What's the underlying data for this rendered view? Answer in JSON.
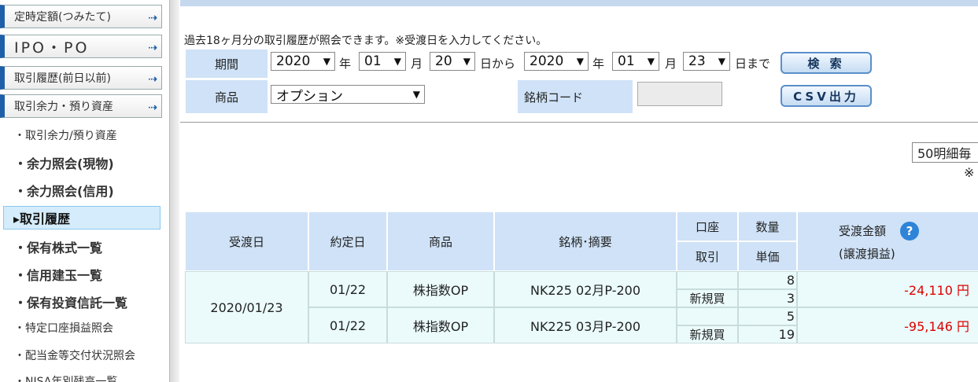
{
  "sidebar": {
    "menus": [
      {
        "label": "定時定額(つみたて)",
        "arrow": "⇢"
      },
      {
        "label": "IPO・PO",
        "arrow": "⇢"
      },
      {
        "label": "取引履歴(前日以前)",
        "arrow": "⇢"
      },
      {
        "label": "取引余力・預り資産",
        "arrow": "⇢"
      }
    ],
    "sub_items": [
      "・取引余力/預り資産",
      "・余力照会(現物)",
      "・余力照会(信用)",
      "・保有株式一覧",
      "・信用建玉一覧",
      "・保有投資信託一覧",
      "・特定口座損益照会",
      "・配当金等交付状況照会",
      "・NISA年別残高一覧"
    ],
    "active_item": "▸取引履歴"
  },
  "search": {
    "intro": "過去18ヶ月分の取引履歴が照会できます。※受渡日を入力してください。",
    "period_label": "期間",
    "product_label": "商品",
    "code_label": "銘柄コード",
    "from_year": "2020",
    "from_month": "01",
    "from_day": "20",
    "to_year": "2020",
    "to_month": "01",
    "to_day": "23",
    "unit_year": "年",
    "unit_month": "月",
    "unit_from": "日から",
    "unit_to": "日まで",
    "product_value": "オプション",
    "search_button": "検 索",
    "csv_button": "CSV出力",
    "dropdown_glyph": "▼"
  },
  "page_size": "50明細毎",
  "note_mark": "※",
  "table": {
    "headers": {
      "delivery_date": "受渡日",
      "trade_date": "約定日",
      "product": "商品",
      "issue": "銘柄･摘要",
      "account": "口座",
      "trade": "取引",
      "qty": "数量",
      "price": "単価",
      "amount": "受渡金額",
      "amount_sub": "(譲渡損益)",
      "help": "?"
    },
    "group_date": "2020/01/23",
    "rows": [
      {
        "trade_date": "01/22",
        "product": "株指数OP",
        "issue": "NK225 02月P-200",
        "account": "",
        "trade": "新規買",
        "qty": "8",
        "price": "3",
        "amount": "-24,110 円"
      },
      {
        "trade_date": "01/22",
        "product": "株指数OP",
        "issue": "NK225 03月P-200",
        "account": "",
        "trade": "新規買",
        "qty": "5",
        "price": "19",
        "amount": "-95,146 円"
      }
    ]
  },
  "colors": {
    "accent": "#1f5fa8",
    "header_bg": "#cfe2f7",
    "row_bg": "#ebfbfb",
    "negative": "#dd0000"
  }
}
